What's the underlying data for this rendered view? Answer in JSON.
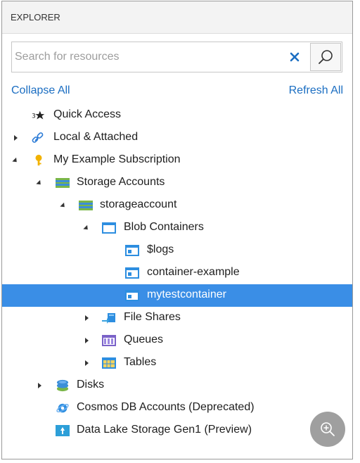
{
  "header": {
    "title": "EXPLORER"
  },
  "search": {
    "placeholder": "Search for resources",
    "value": ""
  },
  "actions": {
    "collapse_all": "Collapse All",
    "refresh_all": "Refresh All"
  },
  "tree": [
    {
      "label": "Quick Access",
      "icon": "quick-access-icon",
      "expanded": null
    },
    {
      "label": "Local & Attached",
      "icon": "link-icon",
      "expanded": false
    },
    {
      "label": "My Example Subscription",
      "icon": "key-icon",
      "expanded": true
    },
    {
      "label": "Storage Accounts",
      "icon": "storage-accounts-icon",
      "expanded": true
    },
    {
      "label": "storageaccount",
      "icon": "storage-account-icon",
      "expanded": true
    },
    {
      "label": "Blob Containers",
      "icon": "blob-containers-icon",
      "expanded": true
    },
    {
      "label": "$logs",
      "icon": "blob-container-icon",
      "expanded": null
    },
    {
      "label": "container-example",
      "icon": "blob-container-icon",
      "expanded": null
    },
    {
      "label": "mytestcontainer",
      "icon": "blob-container-icon",
      "expanded": null,
      "selected": true
    },
    {
      "label": "File Shares",
      "icon": "file-shares-icon",
      "expanded": false
    },
    {
      "label": "Queues",
      "icon": "queues-icon",
      "expanded": false
    },
    {
      "label": "Tables",
      "icon": "tables-icon",
      "expanded": false
    },
    {
      "label": "Disks",
      "icon": "disks-icon",
      "expanded": false
    },
    {
      "label": "Cosmos DB Accounts (Deprecated)",
      "icon": "cosmos-db-icon",
      "expanded": null
    },
    {
      "label": "Data Lake Storage Gen1 (Preview)",
      "icon": "data-lake-icon",
      "expanded": null
    }
  ],
  "colors": {
    "accent": "#1b6ec2",
    "selected_bg": "#3a8ee6"
  }
}
